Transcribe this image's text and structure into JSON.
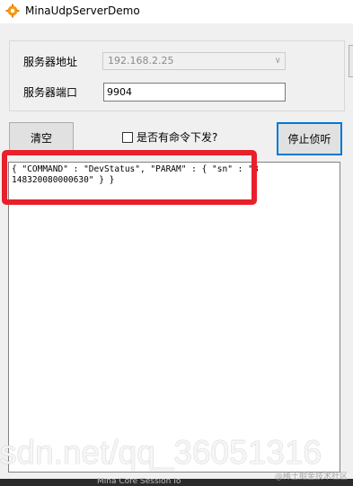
{
  "window": {
    "title": "MinaUdpServerDemo"
  },
  "form": {
    "server_address_label": "服务器地址",
    "server_address_value": "192.168.2.25",
    "server_port_label": "服务器端口",
    "server_port_value": "9904"
  },
  "toolbar": {
    "clear_label": "清空",
    "issue_command_label": "是否有命令下发?",
    "issue_command_checked": false,
    "stop_listen_label": "停止侦听"
  },
  "log": {
    "text": "{ \"COMMAND\" : \"DevStatus\", \"PARAM\" : { \"sn\" : \"8148320080000630\" } }"
  },
  "watermark": {
    "main": "sdn.net/qq_36051316",
    "small": "@稀土掘金技术社区"
  },
  "taskbar": {
    "item": "Mina Core Session Io"
  },
  "colors": {
    "highlight": "#e8202a",
    "focus_border": "#0078d7"
  },
  "icons": {
    "app": "orange-gear-icon",
    "combo_arrow": "chevron-down-icon"
  }
}
